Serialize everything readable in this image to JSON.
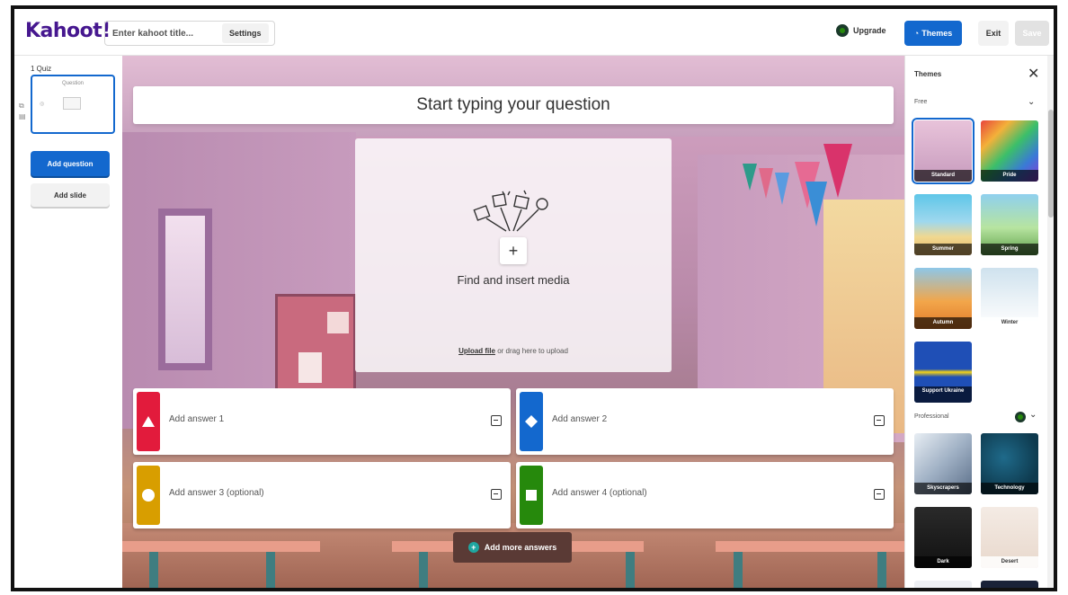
{
  "header": {
    "logo": "Kahoot!",
    "title_placeholder": "Enter kahoot title...",
    "settings_label": "Settings",
    "upgrade_label": "Upgrade",
    "themes_label": "Themes",
    "exit_label": "Exit",
    "save_label": "Save"
  },
  "sidebar": {
    "slide_label": "1 Quiz",
    "thumb_question": "Question",
    "add_question_label": "Add question",
    "add_slide_label": "Add slide"
  },
  "editor": {
    "question_placeholder": "Start typing your question",
    "media_title": "Find and insert media",
    "upload_link": "Upload file",
    "upload_rest": "or drag here to upload",
    "answers": [
      {
        "label": "Add answer 1",
        "color": "#e21b3c",
        "shape": "triangle"
      },
      {
        "label": "Add answer 2",
        "color": "#1368ce",
        "shape": "diamond"
      },
      {
        "label": "Add answer 3 (optional)",
        "color": "#d89e00",
        "shape": "circle"
      },
      {
        "label": "Add answer 4 (optional)",
        "color": "#26890c",
        "shape": "square"
      }
    ],
    "add_more_label": "Add more answers"
  },
  "themes_panel": {
    "title": "Themes",
    "free_label": "Free",
    "professional_label": "Professional",
    "free_themes": [
      "Standard",
      "Pride",
      "Summer",
      "Spring",
      "Autumn",
      "Winter",
      "Support Ukraine"
    ],
    "pro_themes": [
      "Skyscrapers",
      "Technology",
      "Dark",
      "Desert"
    ]
  },
  "colors": {
    "brand": "#46178f",
    "primary_blue": "#1368ce",
    "answer_red": "#e21b3c",
    "answer_blue": "#1368ce",
    "answer_yellow": "#d89e00",
    "answer_green": "#26890c"
  }
}
